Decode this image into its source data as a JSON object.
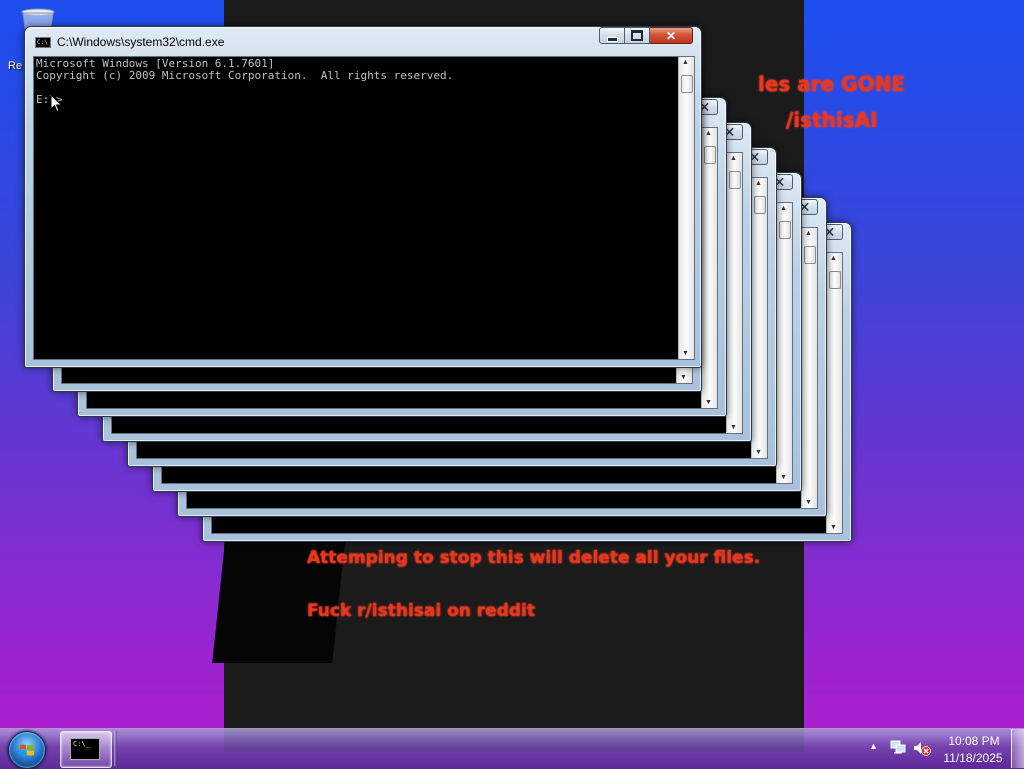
{
  "desktop": {
    "recycle_label": "Re",
    "warnings": [
      "les are GONE",
      "/isthisAI",
      "Attemping to stop this will delete all your files.",
      "Fuck r/isthisai on reddit"
    ]
  },
  "main_window": {
    "title": "C:\\Windows\\system32\\cmd.exe",
    "title_icon": "C:\\",
    "console_text": "Microsoft Windows [Version 6.1.7601]\nCopyright (c) 2009 Microsoft Corporation.  All rights reserved.\n\nE:\\>",
    "close_glyph": "✕"
  },
  "stacked_window_count": 7,
  "taskbar": {
    "task_icon_text": "C:\\_",
    "tray_arrow": "▲",
    "time": "10:08 PM",
    "date": "11/18/2025"
  },
  "colors": {
    "warning_red": "#e8361f",
    "console_bg": "#000000",
    "console_text": "#c0c0c0"
  }
}
